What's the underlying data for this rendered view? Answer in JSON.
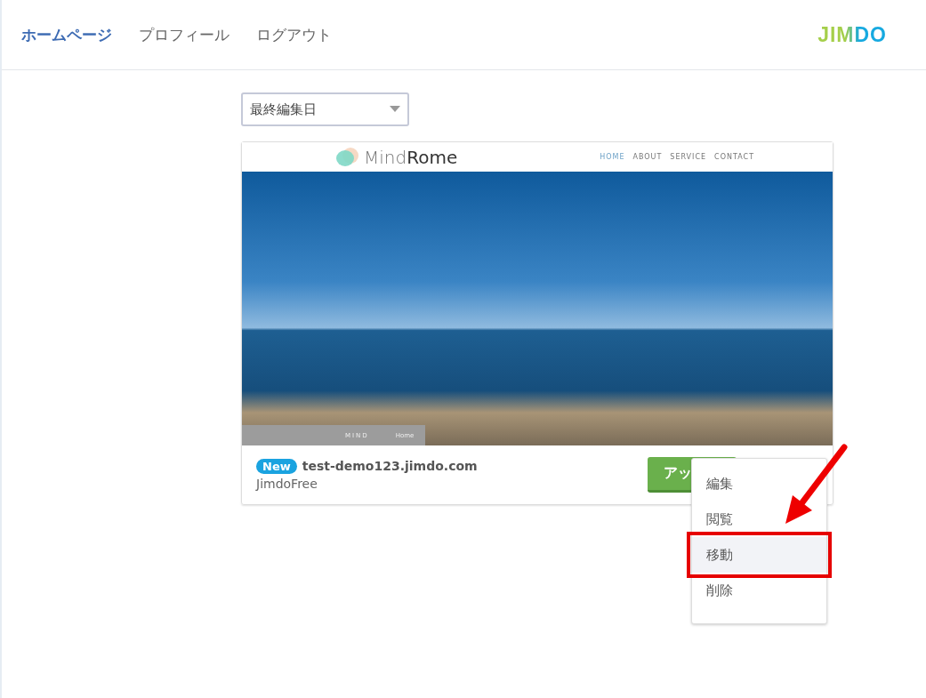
{
  "nav": {
    "items": [
      {
        "label": "ホームページ",
        "selected": true
      },
      {
        "label": "プロフィール",
        "selected": false
      },
      {
        "label": "ログアウト",
        "selected": false
      }
    ],
    "logo": "JIMDO"
  },
  "sort_dropdown": {
    "value": "最終編集日"
  },
  "site_card": {
    "preview": {
      "brand_light": "Mind",
      "brand_bold": "Rome",
      "menu": [
        {
          "label": "HOME",
          "selected": true
        },
        {
          "label": "ABOUT",
          "selected": false
        },
        {
          "label": "SERVICE",
          "selected": false
        },
        {
          "label": "CONTACT",
          "selected": false
        }
      ],
      "footer_brand": "MIND",
      "footer_link": "Home"
    },
    "badge": "New",
    "url": "test-demo123.jimdo.com",
    "plan": "JimdoFree",
    "button": "アッ",
    "menu": [
      {
        "label": "編集",
        "selected": false
      },
      {
        "label": "閲覧",
        "selected": false
      },
      {
        "label": "移動",
        "selected": true
      },
      {
        "label": "削除",
        "selected": false
      }
    ]
  }
}
